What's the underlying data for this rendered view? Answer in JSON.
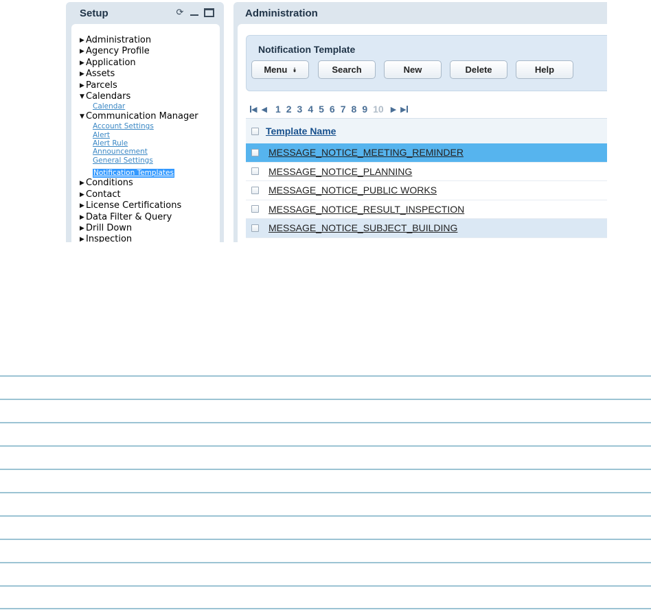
{
  "setup": {
    "title": "Setup",
    "tree": [
      {
        "label": "Administration",
        "state": "collapsed"
      },
      {
        "label": "Agency Profile",
        "state": "collapsed"
      },
      {
        "label": "Application",
        "state": "collapsed"
      },
      {
        "label": "Assets",
        "state": "collapsed"
      },
      {
        "label": "Parcels",
        "state": "collapsed"
      },
      {
        "label": "Calendars",
        "state": "expanded",
        "children": [
          {
            "label": "Calendar"
          }
        ]
      },
      {
        "label": "Communication Manager",
        "state": "expanded",
        "children": [
          {
            "label": "Account Settings"
          },
          {
            "label": "Alert"
          },
          {
            "label": "Alert Rule"
          },
          {
            "label": "Announcement"
          },
          {
            "label": "General Settings"
          },
          {
            "label": "Notification Templates",
            "selected": true
          }
        ]
      },
      {
        "label": "Conditions",
        "state": "collapsed"
      },
      {
        "label": "Contact",
        "state": "collapsed"
      },
      {
        "label": "License Certifications",
        "state": "collapsed"
      },
      {
        "label": "Data Filter & Query",
        "state": "collapsed"
      },
      {
        "label": "Drill Down",
        "state": "collapsed"
      },
      {
        "label": "Inspection",
        "state": "collapsed"
      }
    ]
  },
  "admin": {
    "title": "Administration",
    "section_title": "Notification Template",
    "buttons": {
      "menu": "Menu",
      "search": "Search",
      "new": "New",
      "delete": "Delete",
      "help": "Help"
    },
    "pager": {
      "pages": [
        "1",
        "2",
        "3",
        "4",
        "5",
        "6",
        "7",
        "8",
        "9",
        "10"
      ],
      "disabled_page": "10"
    },
    "grid": {
      "column": "Template Name",
      "rows": [
        {
          "name": "MESSAGE_NOTICE_MEETING_REMINDER",
          "selected": true
        },
        {
          "name": "MESSAGE_NOTICE_PLANNING"
        },
        {
          "name": "MESSAGE_NOTICE_PUBLIC WORKS"
        },
        {
          "name": "MESSAGE_NOTICE_RESULT_INSPECTION"
        },
        {
          "name": "MESSAGE_NOTICE_SUBJECT_BUILDING",
          "alt": true
        }
      ]
    }
  },
  "colors": {
    "panel_bg": "#dde6ee",
    "selection": "#56b4ee",
    "link": "#3a87c4",
    "ruled_line": "#9bc3d3"
  }
}
